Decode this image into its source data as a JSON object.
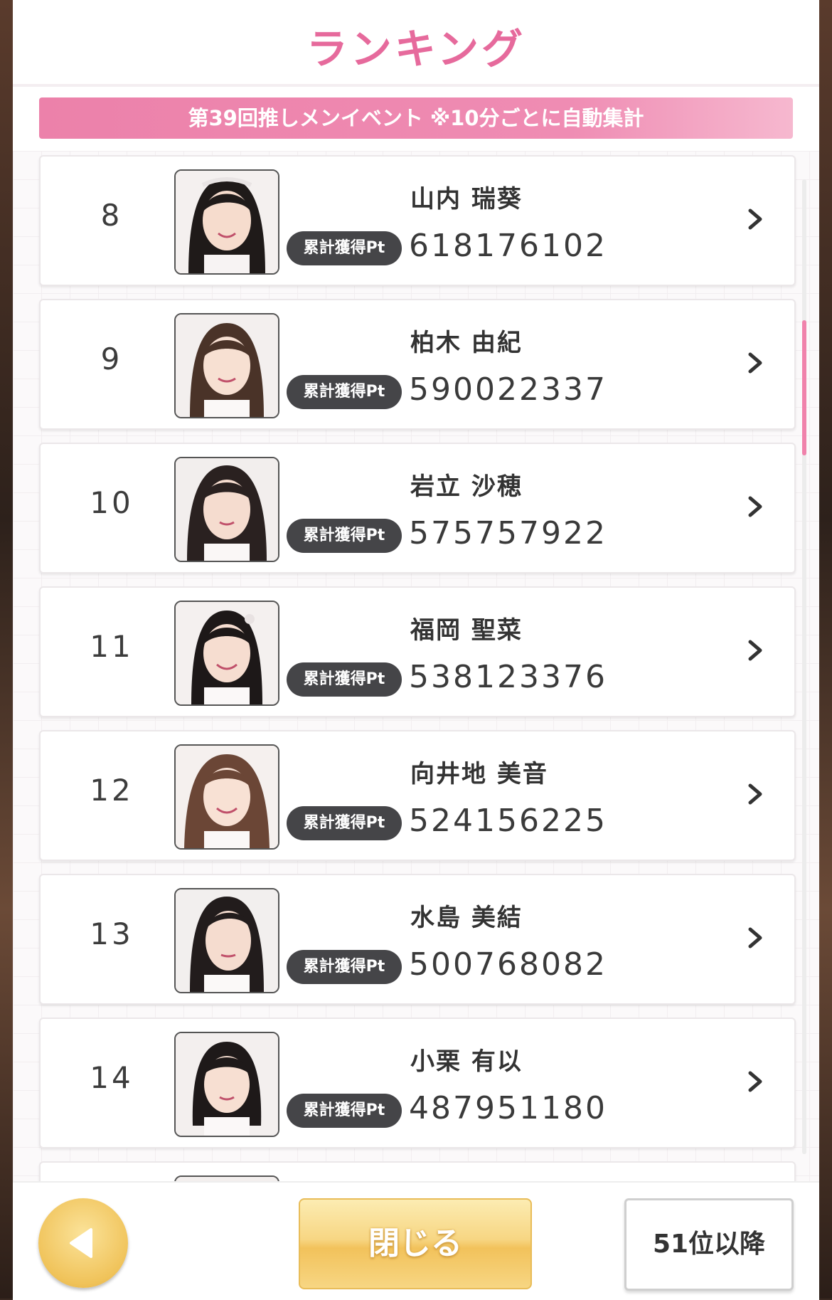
{
  "header": {
    "title": "ランキング"
  },
  "banner": {
    "text": "第39回推しメンイベント ※10分ごとに自動集計"
  },
  "rows": [
    {
      "rank": "8",
      "badge": "累計獲得Pt",
      "name": "山内 瑞葵",
      "points": "618176102"
    },
    {
      "rank": "9",
      "badge": "累計獲得Pt",
      "name": "柏木 由紀",
      "points": "590022337"
    },
    {
      "rank": "10",
      "badge": "累計獲得Pt",
      "name": "岩立 沙穂",
      "points": "575757922"
    },
    {
      "rank": "11",
      "badge": "累計獲得Pt",
      "name": "福岡 聖菜",
      "points": "538123376"
    },
    {
      "rank": "12",
      "badge": "累計獲得Pt",
      "name": "向井地 美音",
      "points": "524156225"
    },
    {
      "rank": "13",
      "badge": "累計獲得Pt",
      "name": "水島 美結",
      "points": "500768082"
    },
    {
      "rank": "14",
      "badge": "累計獲得Pt",
      "name": "小栗 有以",
      "points": "487951180"
    }
  ],
  "footer": {
    "back_icon": "triangle-left-icon",
    "close_label": "閉じる",
    "more_label": "51位以降"
  },
  "colors": {
    "title": "#e66a9c",
    "banner": "#ec81aa",
    "badge": "#454548",
    "button_gold": "#f2c25b"
  }
}
